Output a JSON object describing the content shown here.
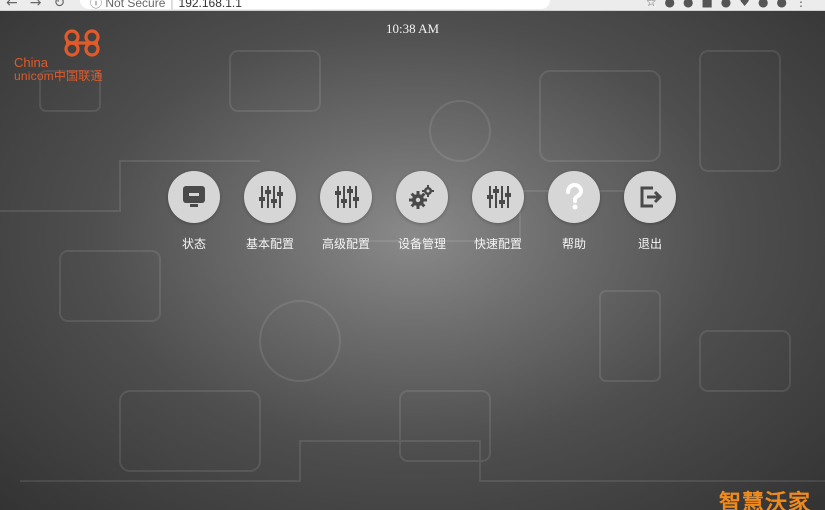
{
  "browser": {
    "security_label": "Not Secure",
    "url": "192.168.1.1"
  },
  "header": {
    "time": "10:38 AM"
  },
  "logo": {
    "line1": "China",
    "line2": "unicom中国联通"
  },
  "menu": {
    "items": [
      {
        "label": "状态",
        "icon": "status-monitor-icon"
      },
      {
        "label": "基本配置",
        "icon": "sliders-icon"
      },
      {
        "label": "高级配置",
        "icon": "advanced-sliders-icon"
      },
      {
        "label": "设备管理",
        "icon": "gears-icon"
      },
      {
        "label": "快速配置",
        "icon": "quick-sliders-icon"
      },
      {
        "label": "帮助",
        "icon": "question-icon"
      },
      {
        "label": "退出",
        "icon": "exit-icon"
      }
    ]
  },
  "brand": {
    "text": "智慧沃家"
  },
  "colors": {
    "accent": "#e05a2a",
    "brand_orange": "#f08a1c",
    "icon_bg": "#d6d6d6",
    "icon_fg": "#4a4a4a"
  }
}
